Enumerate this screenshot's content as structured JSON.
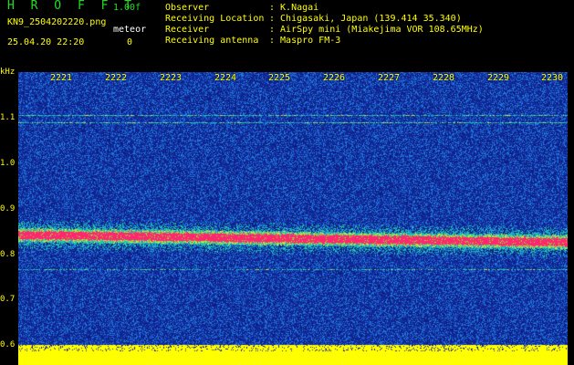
{
  "header": {
    "title": "H R O F F T",
    "version": "1.00f",
    "filename": "KN9_2504202220.png",
    "datetime": "25.04.20 22:20",
    "meteor_label": "meteor",
    "meteor_count": "0"
  },
  "info": [
    {
      "label": "Observer",
      "value": ": K.Nagai"
    },
    {
      "label": "Receiving Location",
      "value": ": Chigasaki, Japan (139.414 35.340)"
    },
    {
      "label": "Receiver",
      "value": ": AirSpy mini (Miakejima VOR 108.65MHz)"
    },
    {
      "label": "Receiving antenna",
      "value": ": Maspro FM-3"
    }
  ],
  "axis": {
    "unit": "kHz",
    "y_ticks": [
      "1.1",
      "1.0",
      "0.9",
      "0.8",
      "0.7",
      "0.6"
    ],
    "x_ticks": [
      "2221",
      "2222",
      "2223",
      "2224",
      "2225",
      "2226",
      "2227",
      "2228",
      "2229",
      "2230"
    ]
  },
  "colors": {
    "background": "#000000",
    "noise": "#1a2aa8",
    "signal_band": "#ff2a6a",
    "baseline": "#ffff00",
    "text_yellow": "#ffff00",
    "text_green": "#22dd22"
  }
}
